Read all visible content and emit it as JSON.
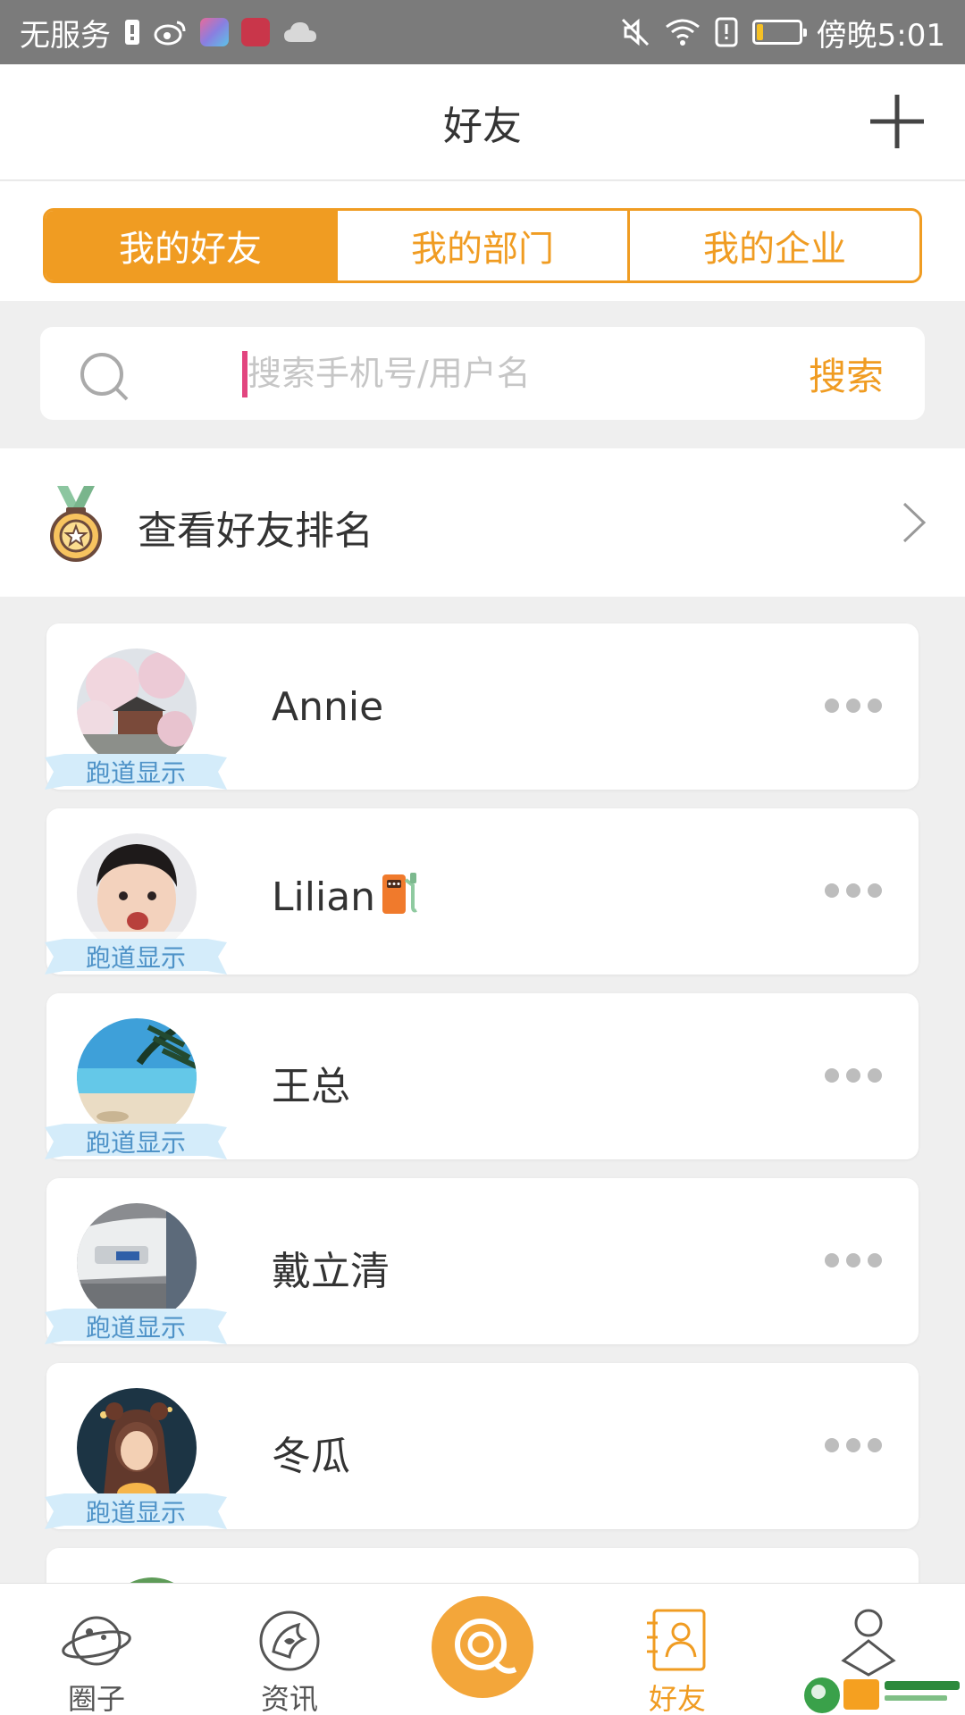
{
  "status_bar": {
    "carrier": "无服务",
    "time": "傍晚5:01",
    "icons": [
      "sim-icon",
      "weibo-icon",
      "app-icon",
      "app-icon",
      "cloud-icon",
      "mute-icon",
      "wifi-icon",
      "notice-icon",
      "battery-icon"
    ],
    "battery_level": 0.15
  },
  "header": {
    "title": "好友",
    "add_icon": "plus-icon"
  },
  "tabs": [
    {
      "label": "我的好友",
      "active": true
    },
    {
      "label": "我的部门",
      "active": false
    },
    {
      "label": "我的企业",
      "active": false
    }
  ],
  "search": {
    "placeholder": "搜索手机号/用户名",
    "value": "",
    "button": "搜索",
    "icon": "search-icon"
  },
  "ranking": {
    "label": "查看好友排名",
    "icon": "medal-icon"
  },
  "badge_label": "跑道显示",
  "friends": [
    {
      "name": "Annie"
    },
    {
      "name": "Lilian"
    },
    {
      "name": "王总"
    },
    {
      "name": "戴立清"
    },
    {
      "name": "冬瓜"
    }
  ],
  "bottom_nav": [
    {
      "label": "圈子",
      "icon": "planet-icon",
      "active": false
    },
    {
      "label": "资讯",
      "icon": "news-icon",
      "active": false
    },
    {
      "label": "",
      "icon": "q-center-icon",
      "active": false
    },
    {
      "label": "好友",
      "icon": "contacts-icon",
      "active": true
    },
    {
      "label": "",
      "icon": "profile-icon",
      "active": false
    }
  ],
  "colors": {
    "accent": "#f09c22",
    "badge_text": "#4f93c8",
    "status_bar": "#7b7b7b",
    "caret": "#e2457f"
  }
}
